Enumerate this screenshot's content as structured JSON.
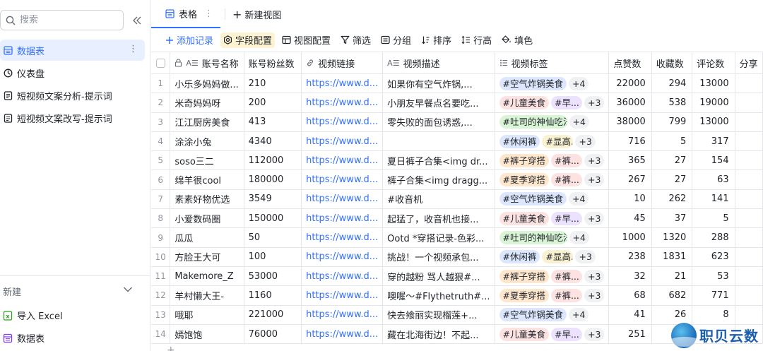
{
  "sidebar": {
    "search_placeholder": "搜索",
    "items": [
      {
        "label": "数据表",
        "active": true
      },
      {
        "label": "仪表盘",
        "active": false
      },
      {
        "label": "短视频文案分析-提示词",
        "active": false
      },
      {
        "label": "短视频文案改写-提示词",
        "active": false
      }
    ],
    "more_label": "⋮",
    "new_label": "新建",
    "create": [
      {
        "label": "导入 Excel",
        "icon": "excel-icon"
      },
      {
        "label": "数据表",
        "icon": "table-icon"
      }
    ]
  },
  "tabs": {
    "active_label": "表格",
    "more": "⋮",
    "add_view": "新建视图"
  },
  "toolbar": {
    "add_record": "添加记录",
    "field_config": "字段配置",
    "view_config": "视图配置",
    "filter": "筛选",
    "group": "分组",
    "sort": "排序",
    "row_height": "行高",
    "fill": "填色"
  },
  "columns": [
    "账号名称",
    "账号粉丝数",
    "视频链接",
    "视频描述",
    "视频标签",
    "点赞数",
    "收藏数",
    "评论数",
    "分享"
  ],
  "rows": [
    {
      "idx": "1",
      "name": "小乐多妈妈做...",
      "fans": "210",
      "link": "https://www.d...",
      "desc": "如果你有空气炸锅,...",
      "tags": [
        {
          "t": "#空气炸锅美食",
          "c": "blue"
        }
      ],
      "more": "+4",
      "likes": "22000",
      "saves": "294",
      "comments": "13000"
    },
    {
      "idx": "2",
      "name": "米奇妈妈呀",
      "fans": "200",
      "link": "https://www.d...",
      "desc": "小朋友早餐点名要吃...",
      "tags": [
        {
          "t": "#儿童美食",
          "c": "pink"
        },
        {
          "t": "#早...",
          "c": "purple"
        }
      ],
      "more": "+3",
      "likes": "36000",
      "saves": "538",
      "comments": "19000"
    },
    {
      "idx": "3",
      "name": "江江厨房美食",
      "fans": "413",
      "link": "https://www.d...",
      "desc": "零失败的面包诱惑,...",
      "tags": [
        {
          "t": "#吐司的神仙吃法",
          "c": "green"
        }
      ],
      "more": "+4",
      "likes": "38000",
      "saves": "799",
      "comments": "13000"
    },
    {
      "idx": "4",
      "name": "涂涂小兔",
      "fans": "4340",
      "link": "https://www.d...",
      "desc": "",
      "tags": [
        {
          "t": "#休闲裤",
          "c": "blue"
        },
        {
          "t": "#显高...",
          "c": "yellow"
        }
      ],
      "more": "+3",
      "likes": "716",
      "saves": "5",
      "comments": "317"
    },
    {
      "idx": "5",
      "name": "soso三二",
      "fans": "112000",
      "link": "https://www.d...",
      "desc": "夏日裤子合集<img dr...",
      "tags": [
        {
          "t": "#裤子穿搭",
          "c": "orange"
        },
        {
          "t": "#裤...",
          "c": "pink"
        }
      ],
      "more": "+3",
      "likes": "365",
      "saves": "27",
      "comments": "154"
    },
    {
      "idx": "6",
      "name": "绵羊很cool",
      "fans": "180000",
      "link": "https://www.d...",
      "desc": "裤子合集<img dragg...",
      "tags": [
        {
          "t": "#夏季穿搭",
          "c": "orange"
        },
        {
          "t": "#裤...",
          "c": "pink"
        }
      ],
      "more": "+3",
      "likes": "267",
      "saves": "27",
      "comments": "63"
    },
    {
      "idx": "7",
      "name": "素素好物优选",
      "fans": "3549",
      "link": "https://www.d...",
      "desc": "#收音机",
      "tags": [
        {
          "t": "#空气炸锅美食",
          "c": "blue"
        }
      ],
      "more": "+4",
      "likes": "10",
      "saves": "262",
      "comments": "141"
    },
    {
      "idx": "8",
      "name": "小爱数码圈",
      "fans": "150000",
      "link": "https://www.d...",
      "desc": "起猛了，收音机也接...",
      "tags": [
        {
          "t": "#儿童美食",
          "c": "pink"
        },
        {
          "t": "#早...",
          "c": "purple"
        }
      ],
      "more": "+3",
      "likes": "45",
      "saves": "37",
      "comments": "5"
    },
    {
      "idx": "9",
      "name": "瓜瓜",
      "fans": "50",
      "link": "https://www.d...",
      "desc": "Ootd *穿搭记录-色彩...",
      "tags": [
        {
          "t": "#吐司的神仙吃法",
          "c": "green"
        }
      ],
      "more": "+4",
      "likes": "1000",
      "saves": "1320",
      "comments": "288"
    },
    {
      "idx": "10",
      "name": "方脸王大可",
      "fans": "100",
      "link": "https://www.d...",
      "desc": "挑战！一个视频承包...",
      "tags": [
        {
          "t": "#休闲裤",
          "c": "blue"
        },
        {
          "t": "#显高...",
          "c": "yellow"
        }
      ],
      "more": "+3",
      "likes": "238",
      "saves": "1831",
      "comments": "623"
    },
    {
      "idx": "11",
      "name": "Makemore_Z",
      "fans": "53000",
      "link": "https://www.d...",
      "desc": "穿的越粉 骂人越狠#...",
      "tags": [
        {
          "t": "#裤子穿搭",
          "c": "orange"
        },
        {
          "t": "#裤...",
          "c": "pink"
        }
      ],
      "more": "+3",
      "likes": "32",
      "saves": "21",
      "comments": "53"
    },
    {
      "idx": "12",
      "name": "羊村懒大王-",
      "fans": "1160",
      "link": "https://www.d...",
      "desc": "噢喔～#Flythetruth#...",
      "tags": [
        {
          "t": "#夏季穿搭",
          "c": "orange"
        },
        {
          "t": "#裤...",
          "c": "pink"
        }
      ],
      "more": "+3",
      "likes": "68",
      "saves": "682",
      "comments": "771"
    },
    {
      "idx": "13",
      "name": "哦耶",
      "fans": "221000",
      "link": "https://www.d...",
      "desc": "快去飨丽实现榴莲+...",
      "tags": [
        {
          "t": "#空气炸锅美食",
          "c": "blue"
        }
      ],
      "more": "+4",
      "likes": "41",
      "saves": "26",
      "comments": "8"
    },
    {
      "idx": "14",
      "name": "嫣饱饱",
      "fans": "76000",
      "link": "https://www.d...",
      "desc": "藏在北海街边！不起...",
      "tags": [
        {
          "t": "#儿童美食",
          "c": "pink"
        },
        {
          "t": "#早...",
          "c": "purple"
        }
      ],
      "more": "+3",
      "likes": "251",
      "saves": "",
      "comments": ""
    }
  ],
  "add_row": "+",
  "watermark": {
    "text": "职贝云数"
  },
  "colors": {
    "accent": "#3370ff",
    "active_bg": "#e8effe",
    "highlight_bg": "#fdf3d3"
  }
}
